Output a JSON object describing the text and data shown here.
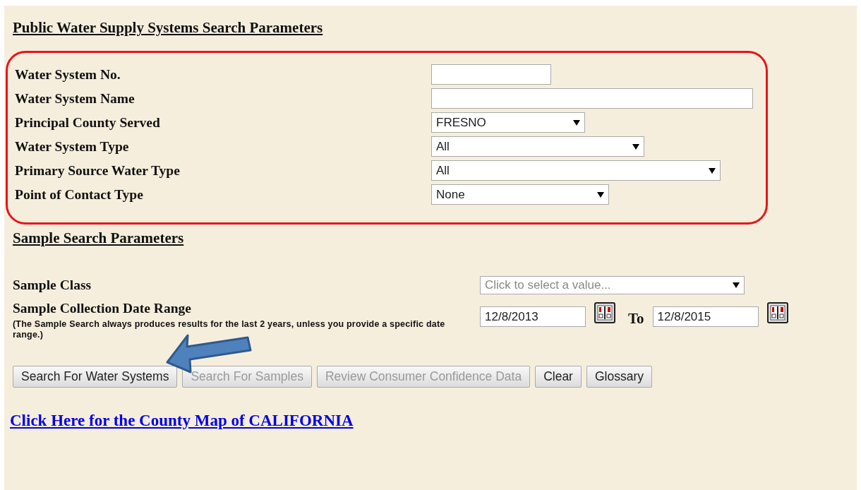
{
  "water_section": {
    "title": "Public Water Supply Systems Search Parameters",
    "highlighted": true,
    "fields": [
      {
        "label": "Water System No.",
        "kind": "text"
      },
      {
        "label": "Water System Name",
        "kind": "text"
      },
      {
        "label": "Principal County Served",
        "kind": "select",
        "value": "FRESNO"
      },
      {
        "label": "Water System Type",
        "kind": "select",
        "value": "All"
      },
      {
        "label": "Primary Source Water Type",
        "kind": "select",
        "value": "All"
      },
      {
        "label": "Point of Contact Type",
        "kind": "select",
        "value": "None"
      }
    ]
  },
  "sample_section": {
    "title": "Sample Search Parameters",
    "sample_class": {
      "label": "Sample Class",
      "placeholder": "Click to select a value..."
    },
    "date_range": {
      "label": "Sample Collection Date Range",
      "note": "(The Sample Search always produces results for the last 2 years, unless you provide a specific date range.)",
      "from": "12/8/2013",
      "separator": "To",
      "to": "12/8/2015"
    }
  },
  "buttons": [
    {
      "label": "Search For Water Systems",
      "disabled": false,
      "pointed_at": true
    },
    {
      "label": "Search For Samples",
      "disabled": true,
      "pointed_at": false
    },
    {
      "label": "Review Consumer Confidence Data",
      "disabled": true,
      "pointed_at": false
    },
    {
      "label": "Clear",
      "disabled": false,
      "pointed_at": false
    },
    {
      "label": "Glossary",
      "disabled": false,
      "pointed_at": false
    }
  ],
  "map_link": "Click Here for the County Map of CALIFORNIA"
}
